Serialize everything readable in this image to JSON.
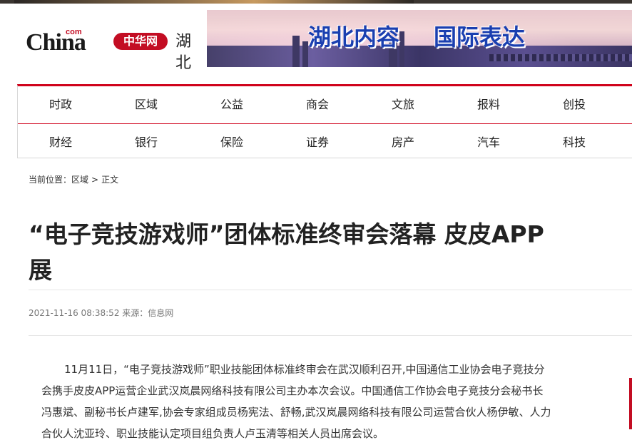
{
  "header": {
    "logo": {
      "china": "China",
      "com": "com",
      "brand": "中华网",
      "region": "湖北"
    },
    "banner": {
      "left_text": "湖北内容",
      "right_text": "国际表达"
    }
  },
  "nav": {
    "row1": [
      "时政",
      "区域",
      "公益",
      "商会",
      "文旅",
      "报料",
      "创投"
    ],
    "row2": [
      "财经",
      "银行",
      "保险",
      "证券",
      "房产",
      "汽车",
      "科技"
    ]
  },
  "breadcrumb": {
    "prefix": "当前位置：",
    "section": "区域",
    "sep": ">",
    "current": "正文"
  },
  "article": {
    "title_line1": "“电子竞技游戏师”团体标准终审会落幕 皮皮APP",
    "title_line2": "展",
    "meta": "2021-11-16 08:38:52 来源：信息网",
    "body_lines": [
      "11月11日，“电子竞技游戏师”职业技能团体标准终审会在武汉顺利召开,中国通信工业协会电子竞技分",
      "会携手皮皮APP运营企业武汉岚晨网络科技有限公司主办本次会议。中国通信工作协会电子竞技分会秘书长",
      "冯惠斌、副秘书长卢建军,协会专家组成员杨宪法、舒畅,武汉岚晨网络科技有限公司运营合伙人杨伊敏、人力",
      "合伙人沈亚玲、职业技能认定项目组负责人卢玉清等相关人员出席会议。"
    ]
  },
  "colors": {
    "accent": "#d0021b",
    "brand": "#c30d23",
    "banner_text": "#1a3fb0"
  }
}
